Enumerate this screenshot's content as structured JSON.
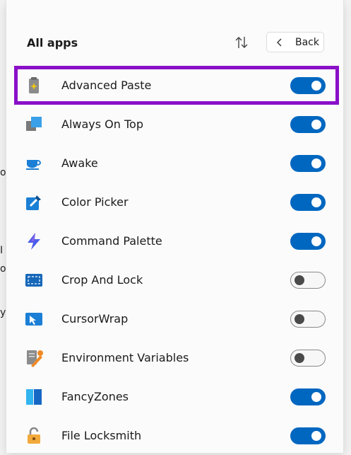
{
  "background_fragments": [
    "o",
    "I",
    "o",
    "y"
  ],
  "panel": {
    "title": "All apps",
    "back_label": "Back"
  },
  "colors": {
    "toggle_on": "#0067c0",
    "highlight_border": "#8a10c8"
  },
  "apps": [
    {
      "name": "Advanced Paste",
      "icon": "advanced-paste-icon",
      "enabled": true,
      "highlighted": true
    },
    {
      "name": "Always On Top",
      "icon": "always-on-top-icon",
      "enabled": true
    },
    {
      "name": "Awake",
      "icon": "awake-cup-icon",
      "enabled": true
    },
    {
      "name": "Color Picker",
      "icon": "color-picker-icon",
      "enabled": true
    },
    {
      "name": "Command Palette",
      "icon": "command-palette-icon",
      "enabled": true
    },
    {
      "name": "Crop And Lock",
      "icon": "crop-and-lock-icon",
      "enabled": false
    },
    {
      "name": "CursorWrap",
      "icon": "cursor-wrap-icon",
      "enabled": false
    },
    {
      "name": "Environment Variables",
      "icon": "environment-variables-icon",
      "enabled": false
    },
    {
      "name": "FancyZones",
      "icon": "fancyzones-icon",
      "enabled": true
    },
    {
      "name": "File Locksmith",
      "icon": "file-locksmith-icon",
      "enabled": true
    }
  ]
}
